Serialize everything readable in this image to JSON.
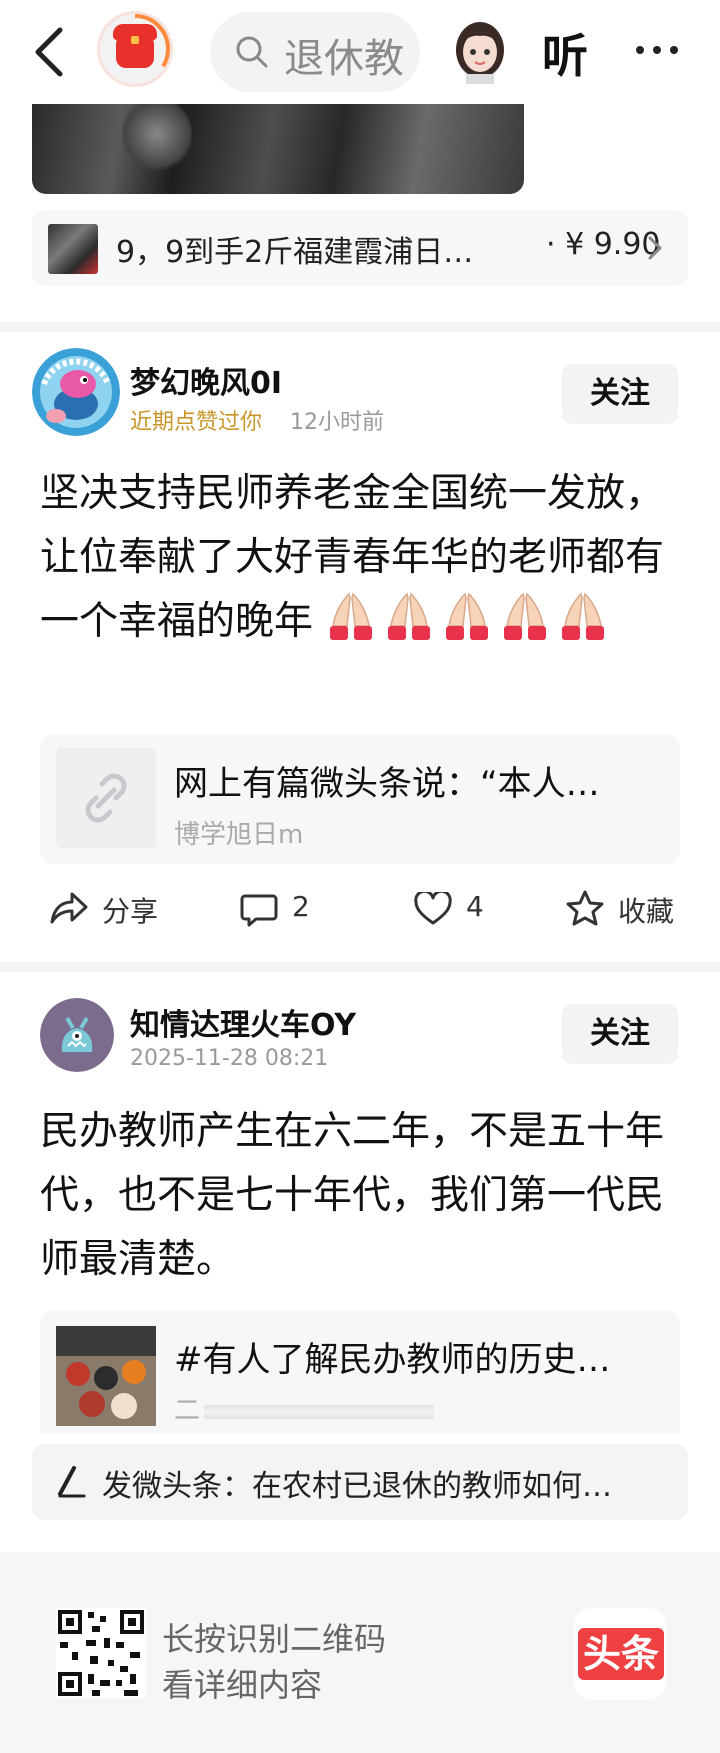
{
  "topbar": {
    "search_placeholder": "退休教",
    "listen_label": "听"
  },
  "product": {
    "title": "9，9到手2斤福建霞浦日…",
    "price": "· ¥ 9.90"
  },
  "post1": {
    "username": "梦幻晚风0I",
    "badge": "近期点赞过你",
    "time": "12小时前",
    "follow_label": "关注",
    "text": "坚决支持民师养老金全国统一发放，让位奉献了大好青春年华的老师都有一个幸福的晚年",
    "emoji_count": 5,
    "link_title": "网上有篇微头条说：“本人…",
    "link_author": "博学旭日m",
    "actions": {
      "share": "分享",
      "comments": "2",
      "likes": "4",
      "favorite": "收藏"
    }
  },
  "post2": {
    "username": "知情达理火车OY",
    "time": "2025-11-28 08:21",
    "follow_label": "关注",
    "text": "民办教师产生在六二年，不是五十年代，也不是七十年代，我们第一代民师最清楚。",
    "link_title": "#有人了解民办教师的历史…",
    "link_sub": "二"
  },
  "ugc_prompt": "发微头条：在农村已退休的教师如何…",
  "footer": {
    "line1": "长按识别二维码",
    "line2": "看详细内容",
    "logo_text": "头条"
  },
  "colors": {
    "brand_red": "#f04142",
    "highlight": "#c9962a",
    "muted": "#999999"
  }
}
